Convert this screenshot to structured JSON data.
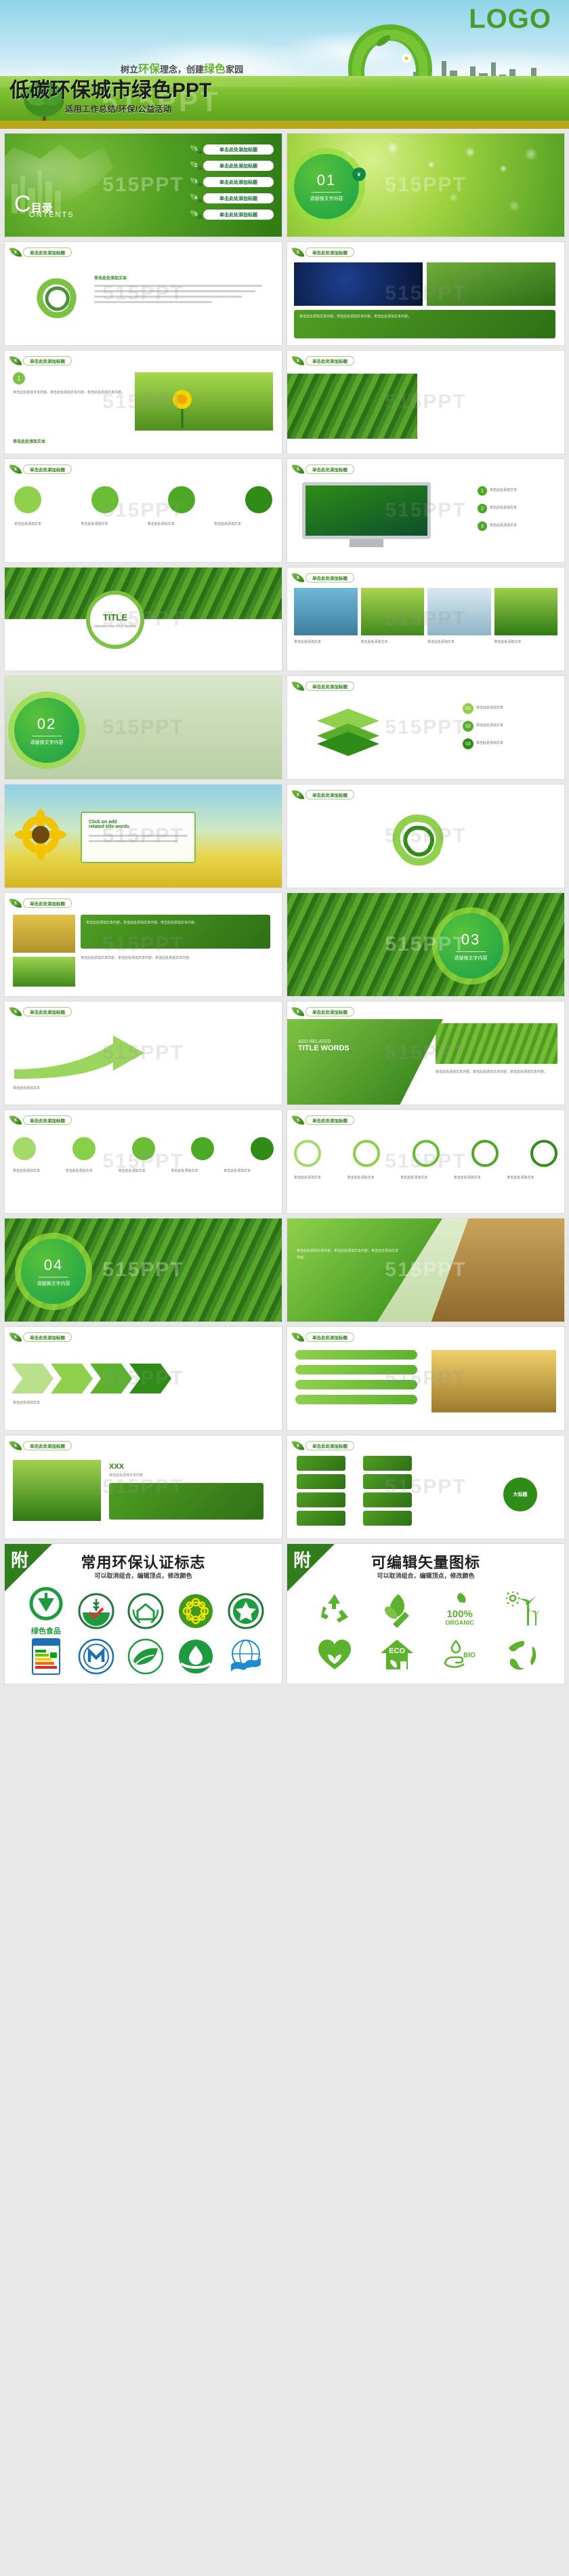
{
  "hero": {
    "logo": "LOGO",
    "tagline_parts": [
      "树立",
      "环保",
      "理念，创建",
      "绿色",
      "家园"
    ],
    "title": "低碳环保城市绿色PPT",
    "subtitle": "适用工作总结/环保/公益活动",
    "watermark": "515PPT"
  },
  "common": {
    "slide_title_placeholder": "单击此处添加标题",
    "section_caption": "请替换文字内容",
    "watermark": "515PPT",
    "body_placeholder": "单击此处添加文本内容，单击此处添加文本内容，单击此处添加文本内容。",
    "short_label": "单击此处添加文本"
  },
  "toc": {
    "letter": "C",
    "cn": "目录",
    "en": "ONTENTS",
    "items": [
      {
        "num": "1",
        "label": "单击此处添加标题"
      },
      {
        "num": "2",
        "label": "单击此处添加标题"
      },
      {
        "num": "3",
        "label": "单击此处添加标题"
      },
      {
        "num": "4",
        "label": "单击此处添加标题"
      },
      {
        "num": "5",
        "label": "单击此处添加标题"
      }
    ]
  },
  "sections": [
    {
      "num": "01",
      "caption": "请替换文字内容"
    },
    {
      "num": "02",
      "caption": "请替换文字内容"
    },
    {
      "num": "03",
      "caption": "请替换文字内容"
    },
    {
      "num": "04",
      "caption": "请替换文字内容"
    }
  ],
  "slides": {
    "s_recycle_title": "单击此处添加标题",
    "s_globe_title": "单击此处添加标题",
    "s_flower_title": "单击此处添加标题",
    "s_tea_title": "单击此处添加标题",
    "s_fourcircles_title": "单击此处添加标题",
    "s_monitor_title": "单击此处添加标题",
    "s_title_circle": "TITLE",
    "s_title_circle_sub": "ADD RELATED TITLE WORDS",
    "s_four_photos_title": "单击此处添加标题",
    "s_click_add": "Click on add",
    "s_related_title": "related title words",
    "s_arrow_title": "ADD RELATED",
    "s_arrow_sub": "TITLE WORDS",
    "s_center_label": "大标题",
    "s_xxx": "XXX",
    "s_xxx_sub": "单击此处添加文本内容"
  },
  "footers": [
    {
      "corner": "附",
      "title": "常用环保认证标志",
      "subtitle": "可以取消组合，编辑顶点，修改颜色",
      "marks": [
        {
          "name": "green-food-mark",
          "caption": "绿色食品"
        },
        {
          "name": "wheat-circle-mark",
          "caption": ""
        },
        {
          "name": "house-wreath-mark",
          "caption": ""
        },
        {
          "name": "flower-yellow-mark",
          "caption": ""
        },
        {
          "name": "star-shield-mark",
          "caption": ""
        },
        {
          "name": "energy-label-mark",
          "caption": ""
        },
        {
          "name": "m-circle-mark",
          "caption": ""
        },
        {
          "name": "leaf-hands-mark",
          "caption": ""
        },
        {
          "name": "water-drop-mark",
          "caption": ""
        },
        {
          "name": "globe-wave-mark",
          "caption": ""
        }
      ]
    },
    {
      "corner": "附",
      "title": "可编辑矢量图标",
      "subtitle": "可以取消组合，编辑顶点，修改颜色",
      "icons": [
        {
          "name": "recycle-icon",
          "label": ""
        },
        {
          "name": "leaf-pair-icon",
          "label": ""
        },
        {
          "name": "organic-icon",
          "label": "100%",
          "sub": "ORGANIC"
        },
        {
          "name": "windmill-icon",
          "label": ""
        },
        {
          "name": "heart-leaf-icon",
          "label": ""
        },
        {
          "name": "eco-house-icon",
          "label": "ECO"
        },
        {
          "name": "bio-hand-icon",
          "label": "BIO"
        },
        {
          "name": "earth-icon",
          "label": ""
        }
      ]
    }
  ]
}
